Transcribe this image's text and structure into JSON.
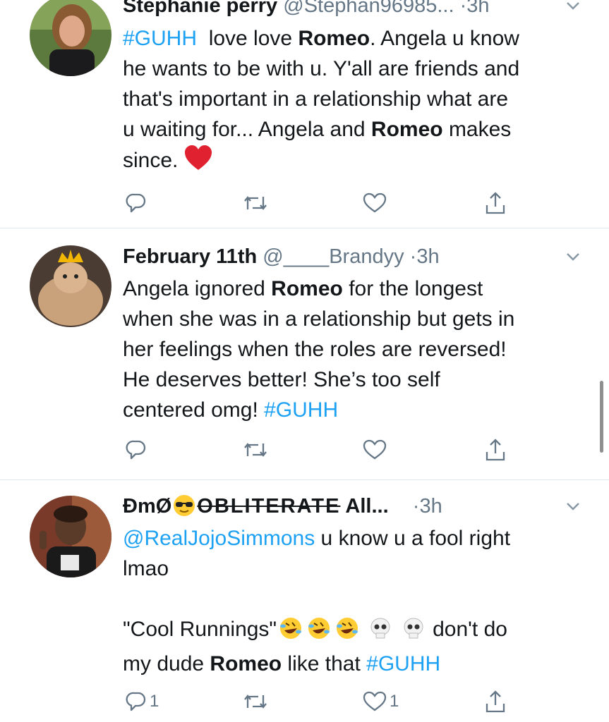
{
  "tweets": [
    {
      "name": "Stephanie perry",
      "handle": "@Stephan96985...",
      "time": "3h",
      "lines": [
        "love love",
        "Romeo",
        ". Angela u know",
        "he wants to be with u. Y'all are friends and",
        "that's important in a relationship  what are",
        "u waiting for...  Angela and ",
        "Romeo",
        " makes",
        "since."
      ],
      "hashtag": "#GUHH",
      "reply_count": "",
      "like_count": ""
    },
    {
      "name": "February 11th",
      "handle": "@____Brandyy",
      "time": "3h",
      "line1_pre": "Angela ignored ",
      "line1_bold": "Romeo",
      "line1_post": " for the longest",
      "line2": "when she was in a relationship but gets in",
      "line3": "her feelings when the roles are reversed!",
      "line4": "He deserves better! She’s too self",
      "line5": "centered omg! ",
      "hashtag": "#GUHH",
      "reply_count": "",
      "like_count": ""
    },
    {
      "name_prefix": "ÐmØ",
      "name_strike": "OBLITERATE",
      "name_suffix": " All...",
      "time": "3h",
      "mention": "@RealJojoSimmons",
      "line1_post": " u know u a fool right",
      "line2": "lmao",
      "line3_pre": "\"Cool Runnings\"",
      "line3_post": " don't do",
      "line4_pre": "my dude ",
      "line4_bold": "Romeo",
      "line4_post": " like that ",
      "hashtag": "#GUHH",
      "reply_count": "1",
      "like_count": "1"
    }
  ],
  "colors": {
    "link": "#1da1f2",
    "secondary": "#657786",
    "divider": "#e1e8ed"
  },
  "icons": [
    "reply-icon",
    "retweet-icon",
    "like-icon",
    "share-icon",
    "chevron-down-icon"
  ]
}
